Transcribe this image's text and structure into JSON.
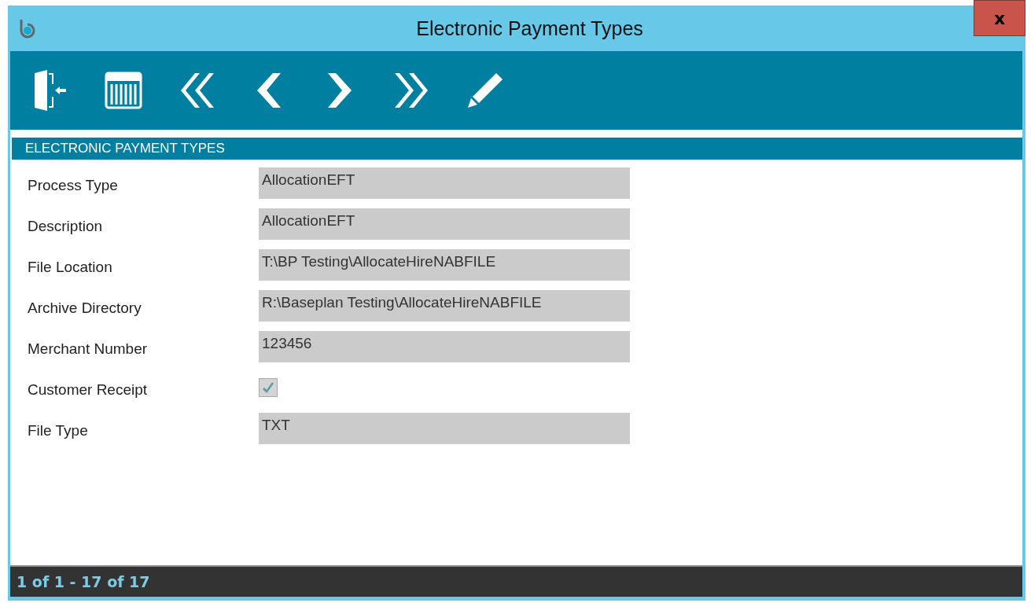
{
  "window": {
    "title": "Electronic Payment Types",
    "close": "x"
  },
  "section": {
    "title": "ELECTRONIC PAYMENT TYPES"
  },
  "fields": [
    {
      "kind": "text",
      "label": "Process Type",
      "value": "AllocationEFT"
    },
    {
      "kind": "text",
      "label": "Description",
      "value": "AllocationEFT"
    },
    {
      "kind": "text",
      "label": "File Location",
      "value": "T:\\BP Testing\\AllocateHireNABFILE"
    },
    {
      "kind": "text",
      "label": "Archive Directory",
      "value": "R:\\Baseplan Testing\\AllocateHireNABFILE"
    },
    {
      "kind": "text",
      "label": "Merchant Number",
      "value": "123456"
    },
    {
      "kind": "checkbox",
      "label": "Customer Receipt",
      "checked": true
    },
    {
      "kind": "text",
      "label": "File Type",
      "value": "TXT"
    }
  ],
  "status_bar": "1 of 1 - 17 of 17"
}
